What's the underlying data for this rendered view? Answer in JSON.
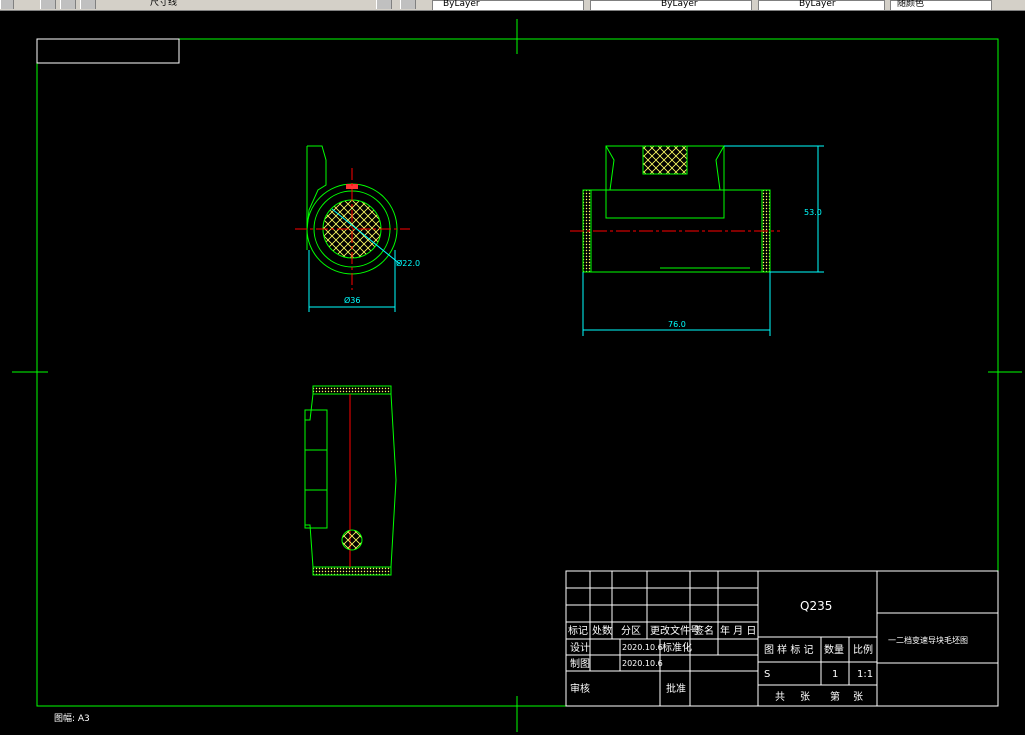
{
  "toolbar": {
    "layer_text": "尺寸线",
    "combo1": "ByLayer",
    "combo2": "ByLayer",
    "combo3": "ByLayer",
    "combo4": "随颜色"
  },
  "drawing": {
    "sheet_size": "图幅: A3"
  },
  "dimensions": {
    "dia_outer": "Ø36",
    "dia_inner": "Ø22.0",
    "height": "53.0",
    "length": "76.0"
  },
  "title_block": {
    "material": "Q235",
    "drawing_name": "一二档变速导块毛坯图",
    "header": {
      "mark": "标记",
      "count": "处数",
      "zone": "分区",
      "change_doc": "更改文件号",
      "sign": "签名",
      "date": "年 月 日"
    },
    "design_label": "设计",
    "design_date": "2020.10.6",
    "std_label": "标准化",
    "drafting_label": "制图",
    "drafting_date": "2020.10.6",
    "review_label": "审核",
    "approve_label": "批准",
    "stage_mark": "图 样 标 记",
    "quantity": "数量",
    "ratio": "比例",
    "stage_value": "S",
    "quantity_value": "1",
    "ratio_value": "1:1",
    "total": "共",
    "sheets1": "张",
    "page": "第",
    "sheets2": "张"
  }
}
